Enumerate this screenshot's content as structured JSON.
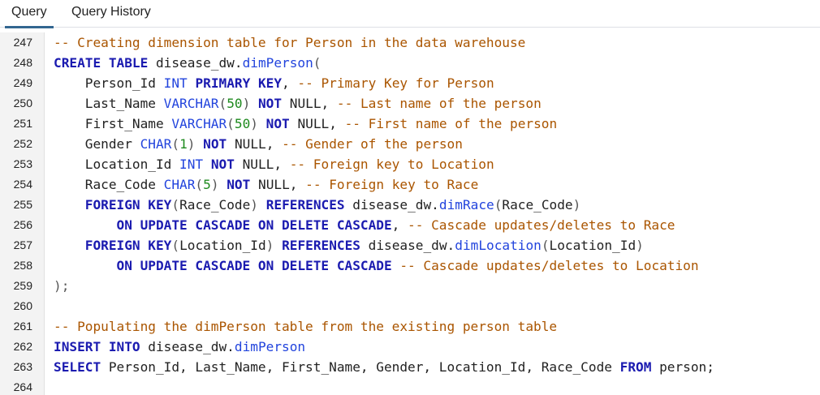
{
  "tabs": [
    {
      "label": "Query",
      "active": true
    },
    {
      "label": "Query History",
      "active": false
    }
  ],
  "colors": {
    "keyword": "#1b1bb0",
    "comment": "#aa5500",
    "type": "#2244dd",
    "number": "#1e8a1e",
    "active_tab_underline": "#326690"
  },
  "editor": {
    "lines": [
      {
        "number": "247",
        "tokens": [
          {
            "t": "cm",
            "v": "-- Creating dimension table for Person in the data warehouse"
          }
        ]
      },
      {
        "number": "248",
        "tokens": [
          {
            "t": "kw",
            "v": "CREATE TABLE"
          },
          {
            "t": "",
            "v": " disease_dw."
          },
          {
            "t": "fn",
            "v": "dimPerson"
          },
          {
            "t": "pn",
            "v": "("
          }
        ]
      },
      {
        "number": "249",
        "tokens": [
          {
            "t": "",
            "v": "    Person_Id "
          },
          {
            "t": "ty",
            "v": "INT"
          },
          {
            "t": "",
            "v": " "
          },
          {
            "t": "kw",
            "v": "PRIMARY KEY"
          },
          {
            "t": "",
            "v": ", "
          },
          {
            "t": "cm",
            "v": "-- Primary Key for Person"
          }
        ]
      },
      {
        "number": "250",
        "tokens": [
          {
            "t": "",
            "v": "    Last_Name "
          },
          {
            "t": "ty",
            "v": "VARCHAR"
          },
          {
            "t": "pn",
            "v": "("
          },
          {
            "t": "nm",
            "v": "50"
          },
          {
            "t": "pn",
            "v": ")"
          },
          {
            "t": "",
            "v": " "
          },
          {
            "t": "kw",
            "v": "NOT"
          },
          {
            "t": "",
            "v": " NULL, "
          },
          {
            "t": "cm",
            "v": "-- Last name of the person"
          }
        ]
      },
      {
        "number": "251",
        "tokens": [
          {
            "t": "",
            "v": "    First_Name "
          },
          {
            "t": "ty",
            "v": "VARCHAR"
          },
          {
            "t": "pn",
            "v": "("
          },
          {
            "t": "nm",
            "v": "50"
          },
          {
            "t": "pn",
            "v": ")"
          },
          {
            "t": "",
            "v": " "
          },
          {
            "t": "kw",
            "v": "NOT"
          },
          {
            "t": "",
            "v": " NULL, "
          },
          {
            "t": "cm",
            "v": "-- First name of the person"
          }
        ]
      },
      {
        "number": "252",
        "tokens": [
          {
            "t": "",
            "v": "    Gender "
          },
          {
            "t": "ty",
            "v": "CHAR"
          },
          {
            "t": "pn",
            "v": "("
          },
          {
            "t": "nm",
            "v": "1"
          },
          {
            "t": "pn",
            "v": ")"
          },
          {
            "t": "",
            "v": " "
          },
          {
            "t": "kw",
            "v": "NOT"
          },
          {
            "t": "",
            "v": " NULL, "
          },
          {
            "t": "cm",
            "v": "-- Gender of the person"
          }
        ]
      },
      {
        "number": "253",
        "tokens": [
          {
            "t": "",
            "v": "    Location_Id "
          },
          {
            "t": "ty",
            "v": "INT"
          },
          {
            "t": "",
            "v": " "
          },
          {
            "t": "kw",
            "v": "NOT"
          },
          {
            "t": "",
            "v": " NULL, "
          },
          {
            "t": "cm",
            "v": "-- Foreign key to Location"
          }
        ]
      },
      {
        "number": "254",
        "tokens": [
          {
            "t": "",
            "v": "    Race_Code "
          },
          {
            "t": "ty",
            "v": "CHAR"
          },
          {
            "t": "pn",
            "v": "("
          },
          {
            "t": "nm",
            "v": "5"
          },
          {
            "t": "pn",
            "v": ")"
          },
          {
            "t": "",
            "v": " "
          },
          {
            "t": "kw",
            "v": "NOT"
          },
          {
            "t": "",
            "v": " NULL, "
          },
          {
            "t": "cm",
            "v": "-- Foreign key to Race"
          }
        ]
      },
      {
        "number": "255",
        "tokens": [
          {
            "t": "",
            "v": "    "
          },
          {
            "t": "kw",
            "v": "FOREIGN KEY"
          },
          {
            "t": "pn",
            "v": "("
          },
          {
            "t": "",
            "v": "Race_Code"
          },
          {
            "t": "pn",
            "v": ")"
          },
          {
            "t": "",
            "v": " "
          },
          {
            "t": "kw",
            "v": "REFERENCES"
          },
          {
            "t": "",
            "v": " disease_dw."
          },
          {
            "t": "fn",
            "v": "dimRace"
          },
          {
            "t": "pn",
            "v": "("
          },
          {
            "t": "",
            "v": "Race_Code"
          },
          {
            "t": "pn",
            "v": ")"
          }
        ]
      },
      {
        "number": "256",
        "tokens": [
          {
            "t": "",
            "v": "        "
          },
          {
            "t": "kw",
            "v": "ON UPDATE CASCADE ON DELETE CASCADE"
          },
          {
            "t": "",
            "v": ", "
          },
          {
            "t": "cm",
            "v": "-- Cascade updates/deletes to Race"
          }
        ]
      },
      {
        "number": "257",
        "tokens": [
          {
            "t": "",
            "v": "    "
          },
          {
            "t": "kw",
            "v": "FOREIGN KEY"
          },
          {
            "t": "pn",
            "v": "("
          },
          {
            "t": "",
            "v": "Location_Id"
          },
          {
            "t": "pn",
            "v": ")"
          },
          {
            "t": "",
            "v": " "
          },
          {
            "t": "kw",
            "v": "REFERENCES"
          },
          {
            "t": "",
            "v": " disease_dw."
          },
          {
            "t": "fn",
            "v": "dimLocation"
          },
          {
            "t": "pn",
            "v": "("
          },
          {
            "t": "",
            "v": "Location_Id"
          },
          {
            "t": "pn",
            "v": ")"
          }
        ]
      },
      {
        "number": "258",
        "tokens": [
          {
            "t": "",
            "v": "        "
          },
          {
            "t": "kw",
            "v": "ON UPDATE CASCADE ON DELETE CASCADE"
          },
          {
            "t": "",
            "v": " "
          },
          {
            "t": "cm",
            "v": "-- Cascade updates/deletes to Location"
          }
        ]
      },
      {
        "number": "259",
        "tokens": [
          {
            "t": "pn",
            "v": ");"
          }
        ]
      },
      {
        "number": "260",
        "tokens": []
      },
      {
        "number": "261",
        "tokens": [
          {
            "t": "cm",
            "v": "-- Populating the dimPerson table from the existing person table"
          }
        ]
      },
      {
        "number": "262",
        "tokens": [
          {
            "t": "kw",
            "v": "INSERT INTO"
          },
          {
            "t": "",
            "v": " disease_dw."
          },
          {
            "t": "fn",
            "v": "dimPerson"
          }
        ]
      },
      {
        "number": "263",
        "tokens": [
          {
            "t": "kw",
            "v": "SELECT"
          },
          {
            "t": "",
            "v": " Person_Id, Last_Name, First_Name, Gender, Location_Id, Race_Code "
          },
          {
            "t": "kw",
            "v": "FROM"
          },
          {
            "t": "",
            "v": " person;"
          }
        ]
      },
      {
        "number": "264",
        "tokens": []
      }
    ]
  }
}
